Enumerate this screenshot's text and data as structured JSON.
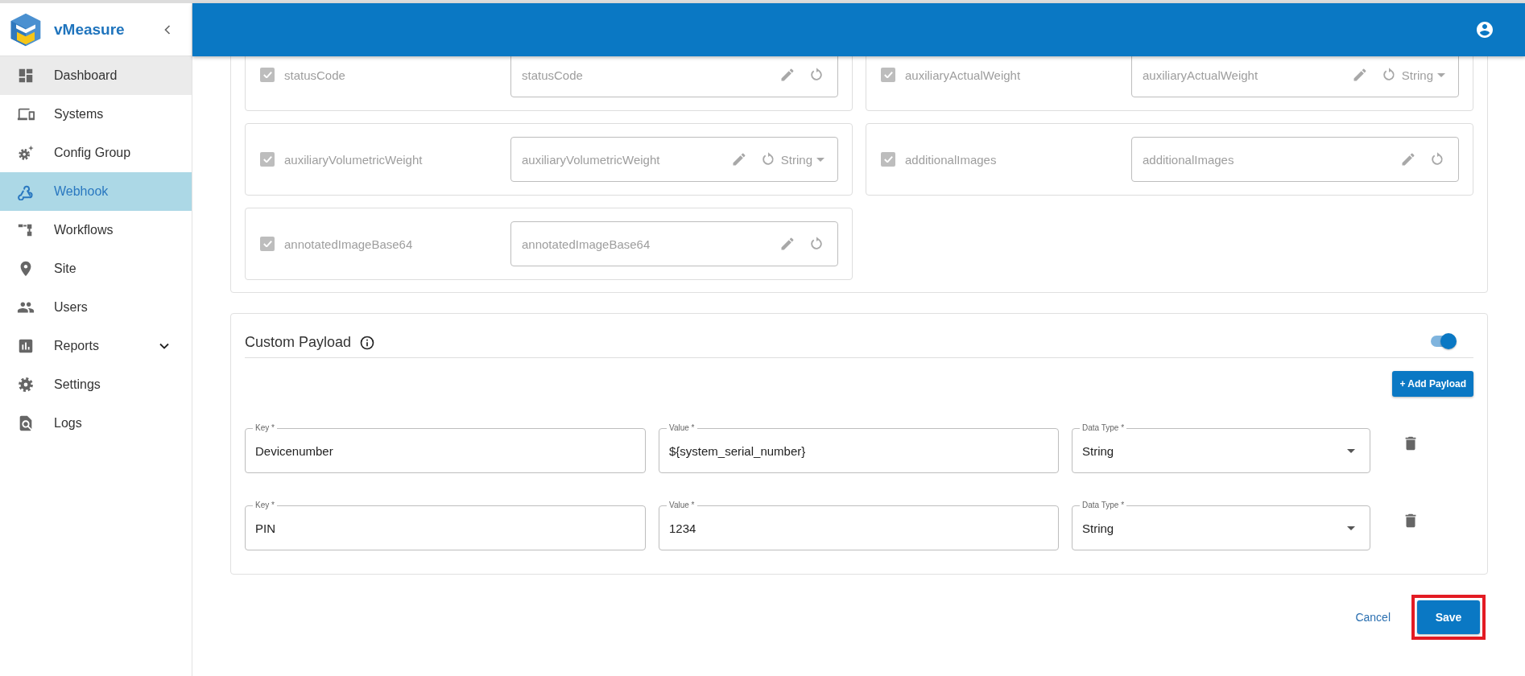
{
  "sidebar": {
    "brand": "vMeasure",
    "items": [
      {
        "label": "Dashboard",
        "selected": false,
        "hovered": true,
        "has_submenu": false
      },
      {
        "label": "Systems",
        "selected": false,
        "hovered": false,
        "has_submenu": false
      },
      {
        "label": "Config Group",
        "selected": false,
        "hovered": false,
        "has_submenu": false
      },
      {
        "label": "Webhook",
        "selected": true,
        "hovered": false,
        "has_submenu": false
      },
      {
        "label": "Workflows",
        "selected": false,
        "hovered": false,
        "has_submenu": false
      },
      {
        "label": "Site",
        "selected": false,
        "hovered": false,
        "has_submenu": false
      },
      {
        "label": "Users",
        "selected": false,
        "hovered": false,
        "has_submenu": false
      },
      {
        "label": "Reports",
        "selected": false,
        "hovered": false,
        "has_submenu": true
      },
      {
        "label": "Settings",
        "selected": false,
        "hovered": false,
        "has_submenu": false
      },
      {
        "label": "Logs",
        "selected": false,
        "hovered": false,
        "has_submenu": false
      }
    ]
  },
  "fields": [
    {
      "label": "statusCode",
      "checked": true,
      "disabled": true,
      "value": "statusCode"
    },
    {
      "label": "auxiliaryActualWeight",
      "checked": true,
      "disabled": true,
      "value": "auxiliaryActualWeight",
      "data_type": "String"
    },
    {
      "label": "auxiliaryVolumetricWeight",
      "checked": true,
      "disabled": true,
      "value": "auxiliaryVolumetricWeight",
      "data_type": "String"
    },
    {
      "label": "additionalImages",
      "checked": true,
      "disabled": true,
      "value": "additionalImages"
    },
    {
      "label": "annotatedImageBase64",
      "checked": true,
      "disabled": true,
      "value": "annotatedImageBase64"
    }
  ],
  "custom_payload": {
    "title": "Custom Payload",
    "enabled": true,
    "add_button": "+ Add Payload",
    "rows": [
      {
        "key_label": "Key *",
        "key": "Devicenumber",
        "value_label": "Value *",
        "value": "${system_serial_number}",
        "type_label": "Data Type *",
        "type": "String"
      },
      {
        "key_label": "Key *",
        "key": "PIN",
        "value_label": "Value *",
        "value": "1234",
        "type_label": "Data Type *",
        "type": "String"
      }
    ]
  },
  "actions": {
    "cancel": "Cancel",
    "save": "Save",
    "save_highlighted": true
  }
}
